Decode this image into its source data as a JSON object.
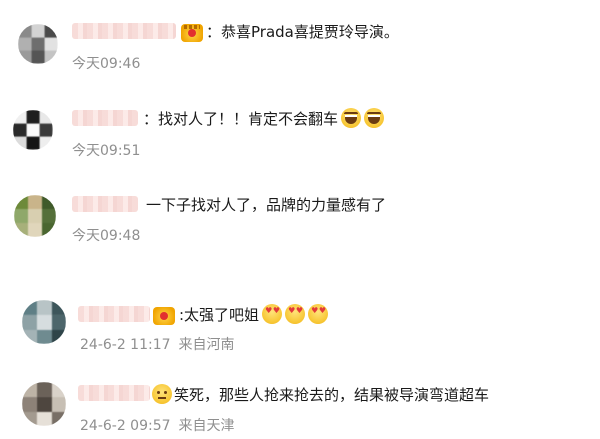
{
  "comments": [
    {
      "text": "：恭喜Prada喜提贾玲导演。",
      "time": "今天09:46",
      "location": "",
      "emojis": [],
      "avatar_colors": [
        "#8a8a8a",
        "#d3d3d3",
        "#4a4a4a",
        "#b0b0b0",
        "#6e6e6e",
        "#e2e2e2",
        "#9a9a9a",
        "#555555",
        "#c4c4c4"
      ]
    },
    {
      "text": "：找对人了！！肯定不会翻车",
      "time": "今天09:51",
      "location": "",
      "emojis": [
        "laugh-emoji",
        "laugh-emoji"
      ],
      "avatar_colors": [
        "#f0f0f0",
        "#1e1e1e",
        "#e8e8e8",
        "#2a2a2a",
        "#fafafa",
        "#3a3a3a",
        "#dcdcdc",
        "#151515",
        "#eeeeee"
      ]
    },
    {
      "text": "一下子找对人了，品牌的力量感有了",
      "time": "今天09:48",
      "location": "",
      "emojis": [],
      "avatar_colors": [
        "#6d8a3a",
        "#c9b48a",
        "#3f5a2a",
        "#8fa86a",
        "#d8cfb0",
        "#55703a",
        "#a7b07a",
        "#e0d6bb",
        "#4a6630"
      ]
    },
    {
      "text": ":太强了吧姐",
      "time": "24-6-2 11:17",
      "location": "来自河南",
      "emojis": [
        "kiss-emoji",
        "kiss-emoji",
        "kiss-emoji"
      ],
      "avatar_colors": [
        "#5f7f86",
        "#b8c4c6",
        "#3d565b",
        "#8ea2a6",
        "#d6dddf",
        "#4d666b",
        "#a4b3b6",
        "#6f8b90",
        "#2f4549"
      ]
    },
    {
      "text": "笑死，那些人抢来抢去的，结果被导演弯道超车",
      "time": "24-6-2 09:57",
      "location": "来自天津",
      "emojis": [],
      "avatar_colors": [
        "#bdb3a6",
        "#6b6259",
        "#d9d2c9",
        "#8d8278",
        "#4e463f",
        "#c7bfb4",
        "#a39a8f",
        "#e6e0d8",
        "#786f66"
      ]
    }
  ],
  "colors": {
    "text": "#1a1a1a",
    "meta": "#8f8f8f",
    "name_blur": "#f6d6d2",
    "emoji_yellow": "#f7c531"
  }
}
